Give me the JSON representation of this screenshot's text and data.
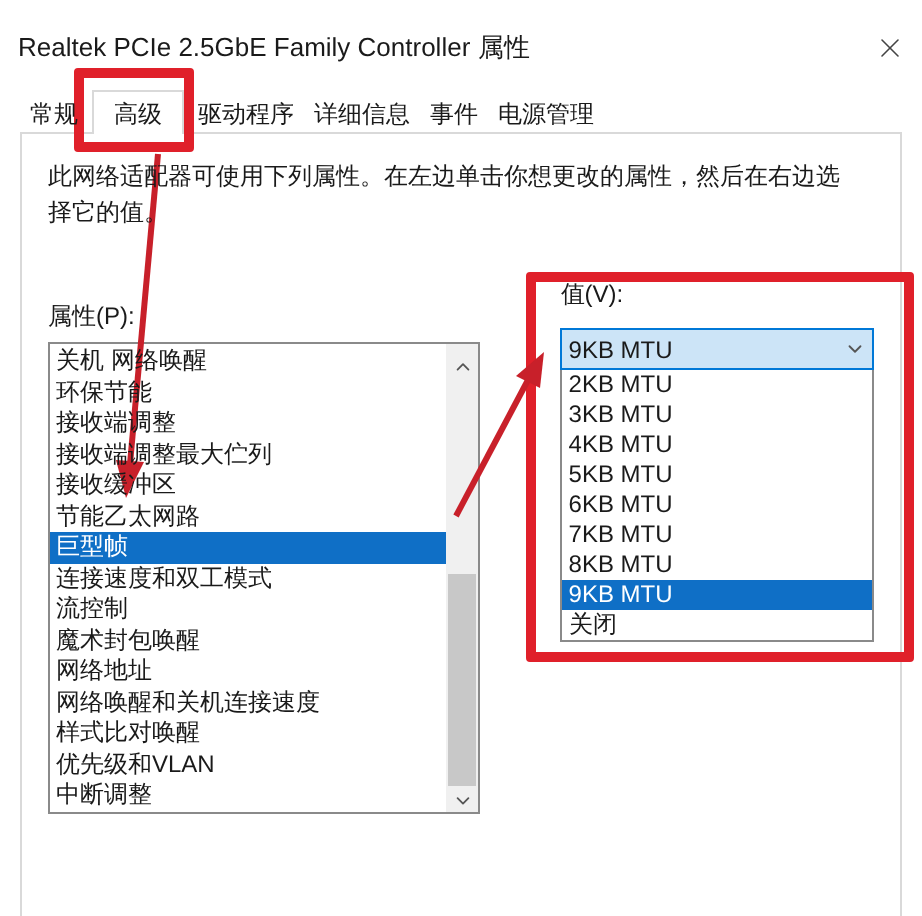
{
  "window": {
    "title": "Realtek PCIe 2.5GbE Family Controller 属性"
  },
  "tabs": [
    {
      "label": "常规",
      "selected": false
    },
    {
      "label": "高级",
      "selected": true
    },
    {
      "label": "驱动程序",
      "selected": false
    },
    {
      "label": "详细信息",
      "selected": false
    },
    {
      "label": "事件",
      "selected": false
    },
    {
      "label": "电源管理",
      "selected": false
    }
  ],
  "description": "此网络适配器可使用下列属性。在左边单击你想更改的属性，然后在右边选择它的值。",
  "properties": {
    "label": "属性(P):",
    "items": [
      {
        "label": "关机 网络唤醒",
        "selected": false
      },
      {
        "label": "环保节能",
        "selected": false
      },
      {
        "label": "接收端调整",
        "selected": false
      },
      {
        "label": "接收端调整最大伫列",
        "selected": false
      },
      {
        "label": "接收缓冲区",
        "selected": false
      },
      {
        "label": "节能乙太网路",
        "selected": false
      },
      {
        "label": "巨型帧",
        "selected": true
      },
      {
        "label": "连接速度和双工模式",
        "selected": false
      },
      {
        "label": "流控制",
        "selected": false
      },
      {
        "label": "魔术封包唤醒",
        "selected": false
      },
      {
        "label": "网络地址",
        "selected": false
      },
      {
        "label": "网络唤醒和关机连接速度",
        "selected": false
      },
      {
        "label": "样式比对唤醒",
        "selected": false
      },
      {
        "label": "优先级和VLAN",
        "selected": false
      },
      {
        "label": "中断调整",
        "selected": false
      }
    ]
  },
  "value": {
    "label": "值(V):",
    "current": "9KB MTU",
    "expanded": true,
    "options": [
      {
        "label": "2KB MTU",
        "selected": false
      },
      {
        "label": "3KB MTU",
        "selected": false
      },
      {
        "label": "4KB MTU",
        "selected": false
      },
      {
        "label": "5KB MTU",
        "selected": false
      },
      {
        "label": "6KB MTU",
        "selected": false
      },
      {
        "label": "7KB MTU",
        "selected": false
      },
      {
        "label": "8KB MTU",
        "selected": false
      },
      {
        "label": "9KB MTU",
        "selected": true
      },
      {
        "label": "关闭",
        "selected": false
      }
    ]
  }
}
